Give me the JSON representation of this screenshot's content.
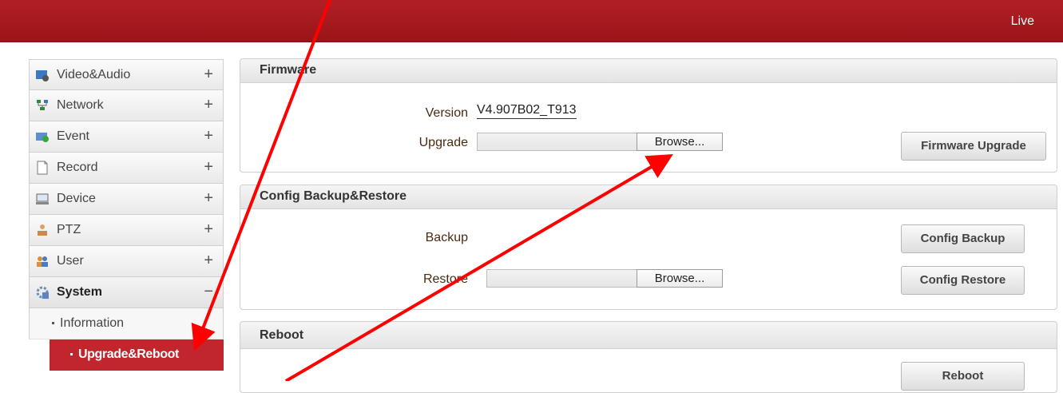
{
  "header": {
    "live_label": "Live"
  },
  "sidebar": {
    "items": [
      {
        "label": "Video&Audio",
        "icon": "video-audio-icon",
        "toggle": "+"
      },
      {
        "label": "Network",
        "icon": "network-icon",
        "toggle": "+"
      },
      {
        "label": "Event",
        "icon": "event-icon",
        "toggle": "+"
      },
      {
        "label": "Record",
        "icon": "record-icon",
        "toggle": "+"
      },
      {
        "label": "Device",
        "icon": "device-icon",
        "toggle": "+"
      },
      {
        "label": "PTZ",
        "icon": "ptz-icon",
        "toggle": "+"
      },
      {
        "label": "User",
        "icon": "user-icon",
        "toggle": "+"
      },
      {
        "label": "System",
        "icon": "system-icon",
        "toggle": "−"
      }
    ],
    "sub_items": [
      {
        "label": "Information"
      },
      {
        "label": "Upgrade&Reboot"
      }
    ]
  },
  "firmware": {
    "title": "Firmware",
    "version_label": "Version",
    "version_value": "V4.907B02_T913",
    "upgrade_label": "Upgrade",
    "browse_label": "Browse...",
    "upgrade_button": "Firmware Upgrade"
  },
  "config": {
    "title": "Config Backup&Restore",
    "backup_label": "Backup",
    "backup_button": "Config Backup",
    "restore_label": "Restore",
    "browse_label": "Browse...",
    "restore_button": "Config Restore"
  },
  "reboot": {
    "title": "Reboot",
    "reboot_button": "Reboot"
  },
  "colors": {
    "brand_red": "#b11f24",
    "selected_red": "#c0262c",
    "annotation_arrow": "#ff0000"
  }
}
